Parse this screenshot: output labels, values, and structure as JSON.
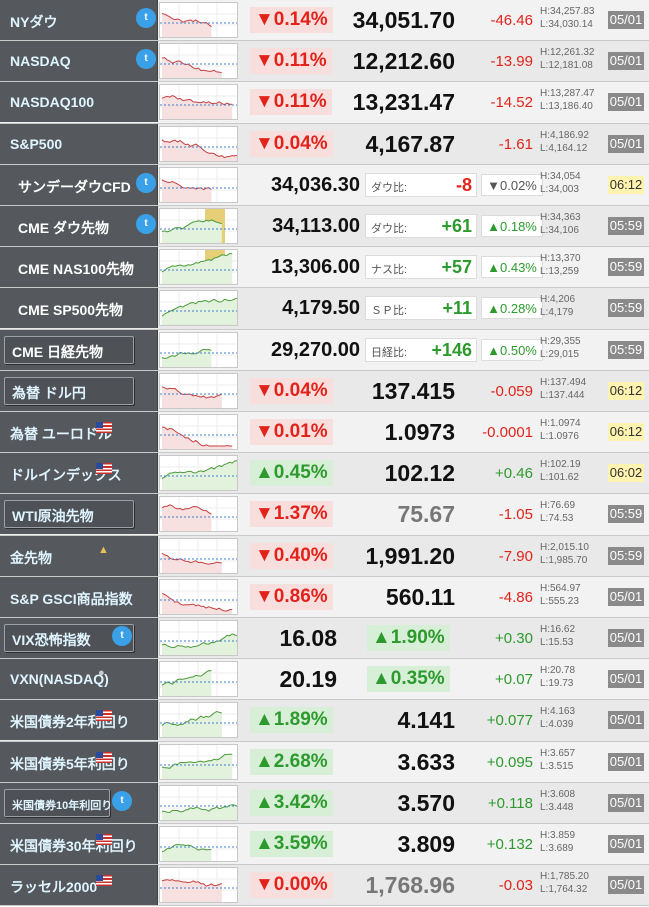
{
  "colors": {
    "up": "#2d9a2d",
    "down": "#e2231a",
    "label_bg": "#55595d",
    "date_hi": "#fff3b0"
  },
  "rows": [
    {
      "type": "std",
      "label": "NYダウ",
      "twitter": true,
      "pct": "▼0.14%",
      "dir": "down",
      "price": "34,051.70",
      "chg": "-46.46",
      "high": "H:34,257.83",
      "low": "L:34,030.14",
      "date": "05/01",
      "hl": false
    },
    {
      "type": "std",
      "label": "NASDAQ",
      "twitter": true,
      "pct": "▼0.11%",
      "dir": "down",
      "price": "12,212.60",
      "chg": "-13.99",
      "high": "H:12,261.32",
      "low": "L:12,181.08",
      "date": "05/01",
      "hl": false
    },
    {
      "type": "std",
      "label": "NASDAQ100",
      "pct": "▼0.11%",
      "dir": "down",
      "price": "13,231.47",
      "chg": "-14.52",
      "high": "H:13,287.47",
      "low": "L:13,186.40",
      "date": "05/01",
      "hl": false
    },
    {
      "type": "std",
      "label": "S&P500",
      "pct": "▼0.04%",
      "dir": "down",
      "price": "4,167.87",
      "chg": "-1.61",
      "high": "H:4,186.92",
      "low": "L:4,164.12",
      "date": "05/01",
      "hl": false
    },
    {
      "type": "fut",
      "label": "サンデーダウCFD",
      "twitter": true,
      "price": "34,036.30",
      "diff_label": "ダウ比:",
      "diff": "-8",
      "diff_dir": "down",
      "diff_pct": "▼0.02%",
      "high": "H:34,054",
      "low": "L:34,003",
      "date": "06:12",
      "hl": true
    },
    {
      "type": "fut",
      "label": "CME ダウ先物",
      "twitter": true,
      "price": "34,113.00",
      "diff_label": "ダウ比:",
      "diff": "+61",
      "diff_dir": "up",
      "diff_pct": "▲0.18%",
      "high": "H:34,363",
      "low": "L:34,106",
      "date": "05:59",
      "hl": false
    },
    {
      "type": "fut",
      "label": "CME NAS100先物",
      "price": "13,306.00",
      "diff_label": "ナス比:",
      "diff": "+57",
      "diff_dir": "up",
      "diff_pct": "▲0.43%",
      "high": "H:13,370",
      "low": "L:13,259",
      "date": "05:59",
      "hl": false
    },
    {
      "type": "fut",
      "label": "CME SP500先物",
      "price": "4,179.50",
      "diff_label": "ＳＰ比:",
      "diff": "+11",
      "diff_dir": "up",
      "diff_pct": "▲0.28%",
      "high": "H:4,206",
      "low": "L:4,179",
      "date": "05:59",
      "hl": false
    },
    {
      "type": "fut",
      "label": "CME 日経先物",
      "button": true,
      "price": "29,270.00",
      "diff_label": "日経比:",
      "diff": "+146",
      "diff_dir": "up",
      "diff_pct": "▲0.50%",
      "high": "H:29,355",
      "low": "L:29,015",
      "date": "05:59",
      "hl": false
    },
    {
      "type": "std",
      "label": "為替 ドル円",
      "button": true,
      "pct": "▼0.04%",
      "dir": "down",
      "price": "137.415",
      "chg": "-0.059",
      "high": "H:137.494",
      "low": "L:137.444",
      "date": "06:12",
      "hl": true
    },
    {
      "type": "std",
      "label": "為替 ユーロドル",
      "flag": true,
      "pct": "▼0.01%",
      "dir": "down",
      "price": "1.0973",
      "chg": "-0.0001",
      "high": "H:1.0974",
      "low": "L:1.0976",
      "date": "06:12",
      "hl": true
    },
    {
      "type": "std",
      "label": "ドルインデックス",
      "flag": true,
      "pct": "▲0.45%",
      "dir": "up",
      "price": "102.12",
      "chg": "+0.46",
      "high": "H:102.19",
      "low": "L:101.62",
      "date": "06:02",
      "hl": true
    },
    {
      "type": "std",
      "label": "WTI原油先物",
      "button": true,
      "pct": "▼1.37%",
      "dir": "down",
      "price": "75.67",
      "price_gray": true,
      "chg": "-1.05",
      "high": "H:76.69",
      "low": "L:74.53",
      "date": "05:59",
      "hl": false
    },
    {
      "type": "std",
      "label": "金先物",
      "gold": true,
      "pct": "▼0.40%",
      "dir": "down",
      "price": "1,991.20",
      "chg": "-7.90",
      "high": "H:2,015.10",
      "low": "L:1,985.70",
      "date": "05:59",
      "hl": false
    },
    {
      "type": "std",
      "label": "S&P GSCI商品指数",
      "pct": "▼0.86%",
      "dir": "down",
      "price": "560.11",
      "chg": "-4.86",
      "high": "H:564.97",
      "low": "L:555.23",
      "date": "05/01",
      "hl": false
    },
    {
      "type": "inv",
      "label": "VIX恐怖指数",
      "button": true,
      "twitter": true,
      "price": "16.08",
      "pct": "▲1.90%",
      "dir": "up",
      "chg": "+0.30",
      "high": "H:16.62",
      "low": "L:15.53",
      "date": "05/01",
      "hl": false
    },
    {
      "type": "inv",
      "label": "VXN(NASDAQ)",
      "avatar": true,
      "price": "20.19",
      "pct": "▲0.35%",
      "dir": "up",
      "chg": "+0.07",
      "high": "H:20.78",
      "low": "L:19.73",
      "date": "05/01",
      "hl": false
    },
    {
      "type": "std",
      "label": "米国債券2年利回り",
      "flag": true,
      "pct": "▲1.89%",
      "dir": "up",
      "price": "4.141",
      "chg": "+0.077",
      "high": "H:4.163",
      "low": "L:4.039",
      "date": "05/01",
      "hl": false
    },
    {
      "type": "std",
      "label": "米国債券5年利回り",
      "flag": true,
      "pct": "▲2.68%",
      "dir": "up",
      "price": "3.633",
      "chg": "+0.095",
      "high": "H:3.657",
      "low": "L:3.515",
      "date": "05/01",
      "hl": false
    },
    {
      "type": "std",
      "label": "米国債券10年利回り",
      "button": true,
      "small": true,
      "twitter": true,
      "pct": "▲3.42%",
      "dir": "up",
      "price": "3.570",
      "chg": "+0.118",
      "high": "H:3.608",
      "low": "L:3.448",
      "date": "05/01",
      "hl": false
    },
    {
      "type": "std",
      "label": "米国債券30年利回り",
      "flag": true,
      "pct": "▲3.59%",
      "dir": "up",
      "price": "3.809",
      "chg": "+0.132",
      "high": "H:3.859",
      "low": "L:3.689",
      "date": "05/01",
      "hl": false
    },
    {
      "type": "std",
      "label": "ラッセル2000",
      "flag": true,
      "pct": "▼0.00%",
      "dir": "down",
      "price": "1,768.96",
      "price_gray": true,
      "chg": "-0.03",
      "high": "H:1,785.20",
      "low": "L:1,764.32",
      "date": "05/01",
      "hl": false
    }
  ]
}
